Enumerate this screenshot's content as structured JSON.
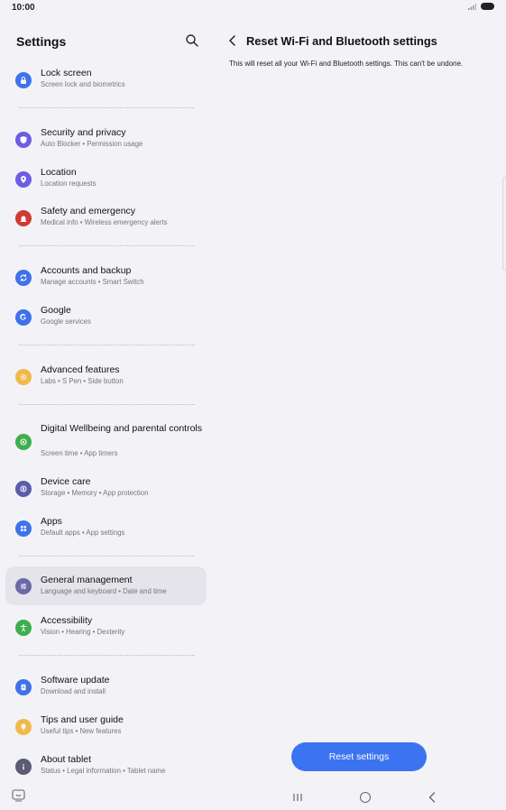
{
  "status": {
    "time": "10:00"
  },
  "left": {
    "header": "Settings",
    "items": [
      {
        "title": "Lock screen",
        "sub": "Screen lock and biometrics",
        "color": "#3f72ea",
        "icon": "lock-icon"
      },
      {
        "title": "Security and privacy",
        "sub": "Auto Blocker  •  Permission usage",
        "color": "#6e5ce6",
        "icon": "shield-icon"
      },
      {
        "title": "Location",
        "sub": "Location requests",
        "color": "#6e5ce6",
        "icon": "location-pin-icon"
      },
      {
        "title": "Safety and emergency",
        "sub": "Medical info  •  Wireless emergency alerts",
        "color": "#cf3b34",
        "icon": "siren-icon"
      },
      {
        "title": "Accounts and backup",
        "sub": "Manage accounts  •  Smart Switch",
        "color": "#3f72ea",
        "icon": "sync-icon"
      },
      {
        "title": "Google",
        "sub": "Google services",
        "color": "#3f72ea",
        "icon": "google-g-icon"
      },
      {
        "title": "Advanced features",
        "sub": "Labs  •  S Pen  •  Side button",
        "color": "#f0b94a",
        "icon": "gear-plus-icon"
      },
      {
        "title": "Digital Wellbeing and parental controls",
        "sub": "Screen time  •  App timers",
        "color": "#3fae4f",
        "icon": "wellbeing-icon"
      },
      {
        "title": "Device care",
        "sub": "Storage  •  Memory  •  App protection",
        "color": "#5b5cad",
        "icon": "device-care-icon"
      },
      {
        "title": "Apps",
        "sub": "Default apps  •  App settings",
        "color": "#3f72ea",
        "icon": "apps-grid-icon"
      },
      {
        "title": "General management",
        "sub": "Language and keyboard  •  Date and time",
        "color": "#6c6aa6",
        "icon": "sliders-icon"
      },
      {
        "title": "Accessibility",
        "sub": "Vision  •  Hearing  •  Dexterity",
        "color": "#3fae4f",
        "icon": "accessibility-icon"
      },
      {
        "title": "Software update",
        "sub": "Download and install",
        "color": "#3f72ea",
        "icon": "software-update-icon"
      },
      {
        "title": "Tips and user guide",
        "sub": "Useful tips  •  New features",
        "color": "#f0b94a",
        "icon": "lightbulb-icon"
      },
      {
        "title": "About tablet",
        "sub": "Status  •  Legal information  •  Tablet name",
        "color": "#5b5c73",
        "icon": "info-icon"
      }
    ]
  },
  "right": {
    "title": "Reset Wi-Fi and Bluetooth settings",
    "description": "This will reset all your Wi-Fi and Bluetooth settings. This can't be undone.",
    "button": "Reset settings",
    "button_color": "#3c73f0"
  }
}
